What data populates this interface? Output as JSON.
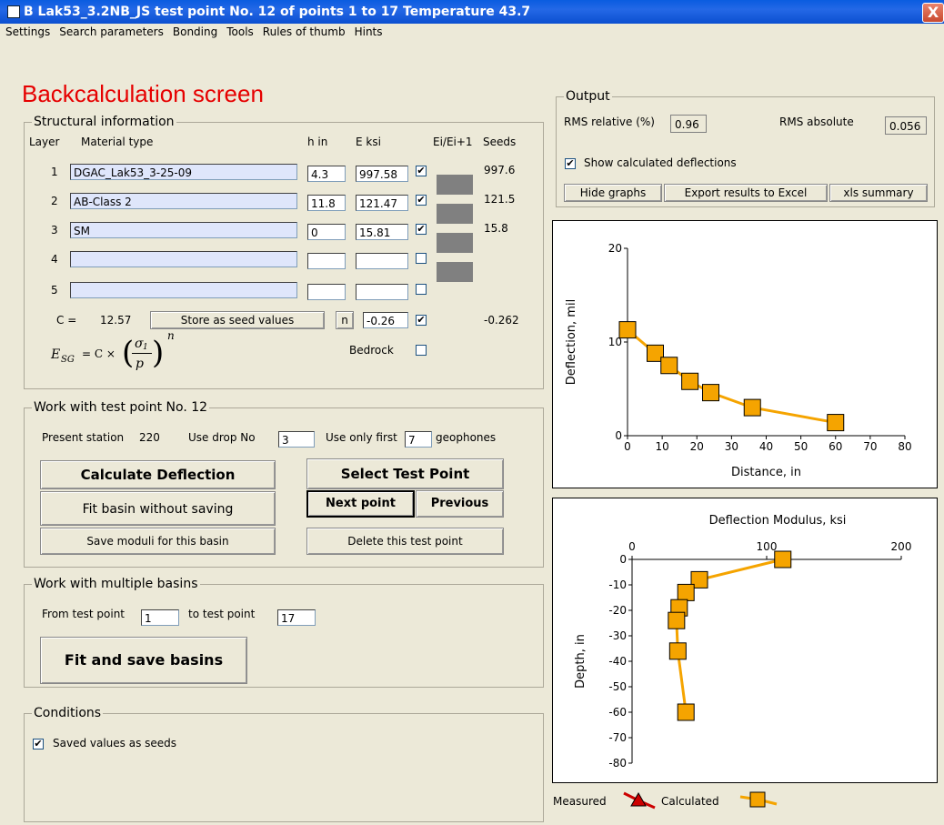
{
  "window": {
    "title": "B  Lak53_3.2NB_JS test point No. 12 of points 1 to 17 Temperature 43.7",
    "close": "X"
  },
  "menu": [
    "Settings",
    "Search parameters",
    "Bonding",
    "Tools",
    "Rules of thumb",
    "Hints"
  ],
  "page_title": "Backcalculation screen",
  "structural": {
    "legend": "Structural information",
    "headers": {
      "layer": "Layer",
      "material": "Material type",
      "h": "h in",
      "e": "E ksi",
      "ratio": "Ei/Ei+1",
      "seeds": "Seeds"
    },
    "layers": [
      {
        "no": "1",
        "material": "DGAC_Lak53_3-25-09",
        "h": "4.3",
        "e": "997.58",
        "checked": "✔",
        "seed": "997.6"
      },
      {
        "no": "2",
        "material": "AB-Class 2",
        "h": "11.8",
        "e": "121.47",
        "checked": "✔",
        "seed": "121.5"
      },
      {
        "no": "3",
        "material": "SM",
        "h": "0",
        "e": "15.81",
        "checked": "✔",
        "seed": "15.8"
      },
      {
        "no": "4",
        "material": "",
        "h": "",
        "e": "",
        "checked": "",
        "seed": ""
      },
      {
        "no": "5",
        "material": "",
        "h": "",
        "e": "",
        "checked": "",
        "seed": ""
      }
    ],
    "c_label": "C =",
    "c_value": "12.57",
    "store_button": "Store as seed values",
    "n_button": "n",
    "n_value": "-0.26",
    "n_checked": "✔",
    "n_seed": "-0.262",
    "bedrock_label": "Bedrock",
    "formula_lhs": "E",
    "formula_sub": "SG",
    "formula_mid": "= C ×",
    "formula_num": "σ",
    "formula_num_sub": "1",
    "formula_den": "p",
    "formula_exp": "n"
  },
  "work_point": {
    "legend": "Work with test point No. 12",
    "present_station_label": "Present station",
    "present_station": "220",
    "drop_label": "Use drop No",
    "drop_value": "3",
    "first_label": "Use only first",
    "first_value": "7",
    "geophones_label": "geophones",
    "calc_button": "Calculate Deflection",
    "fit_button": "Fit basin without saving",
    "save_button": "Save moduli for this basin",
    "select_button": "Select Test Point",
    "next_button": "Next point",
    "prev_button": "Previous",
    "delete_button": "Delete this test point"
  },
  "multiple": {
    "legend": "Work with multiple basins",
    "from_label": "From test point",
    "from_value": "1",
    "to_label": "to test point",
    "to_value": "17",
    "fit_save_button": "Fit and save basins"
  },
  "conditions": {
    "legend": "Conditions",
    "seeds_label": "Saved values as seeds",
    "seeds_checked": "✔"
  },
  "output": {
    "legend": "Output",
    "rms_rel_label": "RMS relative (%)",
    "rms_rel": "0.96",
    "rms_abs_label": "RMS absolute",
    "rms_abs": "0.056",
    "show_label": "Show calculated deflections",
    "show_checked": "✔",
    "hide_button": "Hide graphs",
    "export_button": "Export results to Excel",
    "xls_button": "xls summary"
  },
  "legend_bottom": {
    "measured": "Measured",
    "calculated": "Calculated"
  },
  "colors": {
    "series": "#f5a400",
    "marker_edge": "#000000",
    "title_red": "#e60000",
    "measured": "#cc0000"
  },
  "chart_data": [
    {
      "type": "line",
      "xlabel": "Distance, in",
      "ylabel": "Deflection, mil",
      "xlim": [
        0,
        80
      ],
      "ylim": [
        0,
        20
      ],
      "xticks": [
        "0",
        "10",
        "20",
        "30",
        "40",
        "50",
        "60",
        "70",
        "80"
      ],
      "yticks": [
        "0",
        "10",
        "20"
      ],
      "series": [
        {
          "name": "Calculated",
          "x": [
            0,
            8,
            12,
            18,
            24,
            36,
            60
          ],
          "y": [
            11.3,
            8.8,
            7.5,
            5.8,
            4.6,
            3.0,
            1.4
          ]
        }
      ]
    },
    {
      "type": "line",
      "title": "Deflection Modulus, ksi",
      "ylabel": "Depth, in",
      "xlim": [
        0,
        200
      ],
      "ylim": [
        -80,
        0
      ],
      "xticks": [
        "0",
        "100",
        "200"
      ],
      "yticks": [
        "0",
        "-10",
        "-20",
        "-30",
        "-40",
        "-50",
        "-60",
        "-70",
        "-80"
      ],
      "series": [
        {
          "name": "Calculated",
          "x": [
            112,
            50,
            40,
            35,
            33,
            34,
            40
          ],
          "y": [
            0,
            -8,
            -13,
            -19,
            -24,
            -36,
            -60
          ]
        }
      ]
    }
  ]
}
